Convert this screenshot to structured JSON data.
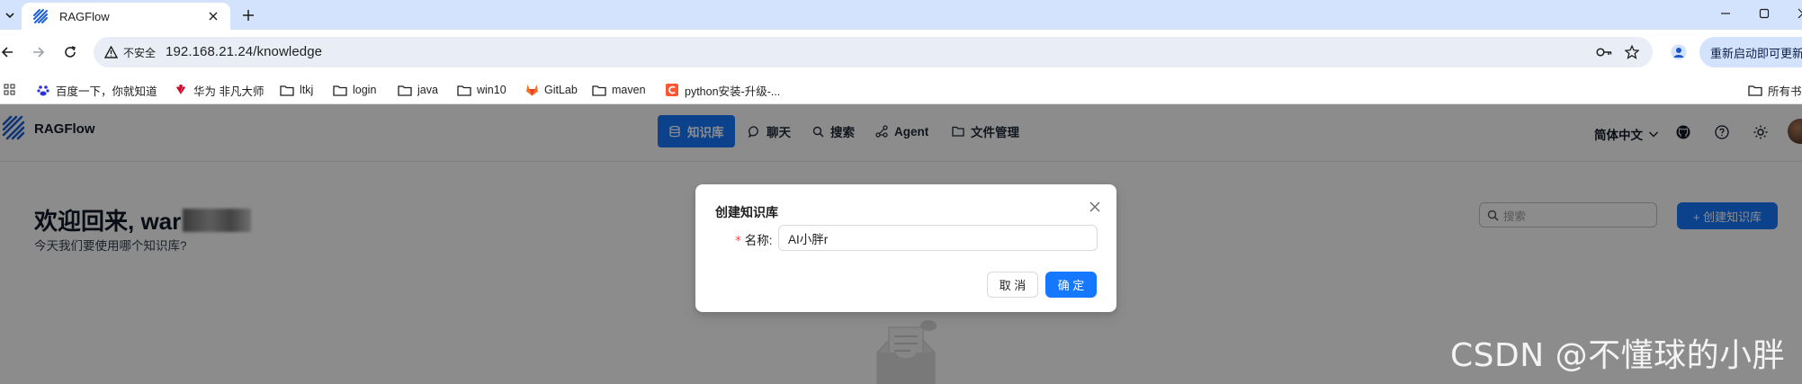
{
  "browser": {
    "tab": {
      "title": "RAGFlow",
      "favicon": "ragflow-logo-icon"
    },
    "window_controls": [
      "minimize-icon",
      "maximize-icon",
      "close-icon"
    ],
    "security_label": "不安全",
    "url": "192.168.21.24/knowledge",
    "relaunch_label": "重新启动即可更新",
    "bookmarks": [
      {
        "label": "百度一下，你就知道",
        "icon": "baidu-icon"
      },
      {
        "label": "华为 非凡大师",
        "icon": "huawei-icon"
      },
      {
        "label": "ltkj",
        "icon": "folder-icon"
      },
      {
        "label": "login",
        "icon": "folder-icon"
      },
      {
        "label": "java",
        "icon": "folder-icon"
      },
      {
        "label": "win10",
        "icon": "folder-icon"
      },
      {
        "label": "GitLab",
        "icon": "gitlab-icon"
      },
      {
        "label": "maven",
        "icon": "folder-icon"
      },
      {
        "label": "python安装-升级-...",
        "icon": "csdn-icon"
      },
      {
        "label": "所有书",
        "icon": "folder-icon"
      }
    ]
  },
  "app": {
    "logo_text": "RAGFlow",
    "nav": [
      {
        "label": "知识库",
        "icon": "database-icon",
        "active": true
      },
      {
        "label": "聊天",
        "icon": "chat-icon",
        "active": false
      },
      {
        "label": "搜索",
        "icon": "search-icon",
        "active": false
      },
      {
        "label": "Agent",
        "icon": "agent-icon",
        "active": false
      },
      {
        "label": "文件管理",
        "icon": "folder-icon",
        "active": false
      }
    ],
    "language": "简体中文",
    "welcome_prefix": "欢迎回来, war",
    "subtitle": "今天我们要使用哪个知识库?",
    "search_placeholder": "搜索",
    "create_button": "+ 创建知识库",
    "accent_color": "#1677ff"
  },
  "modal": {
    "title": "创建知识库",
    "required_mark": "*",
    "name_label": "名称:",
    "name_value": "AI小胖r",
    "cancel_label": "取 消",
    "ok_label": "确 定"
  },
  "watermark": "CSDN @不懂球的小胖"
}
